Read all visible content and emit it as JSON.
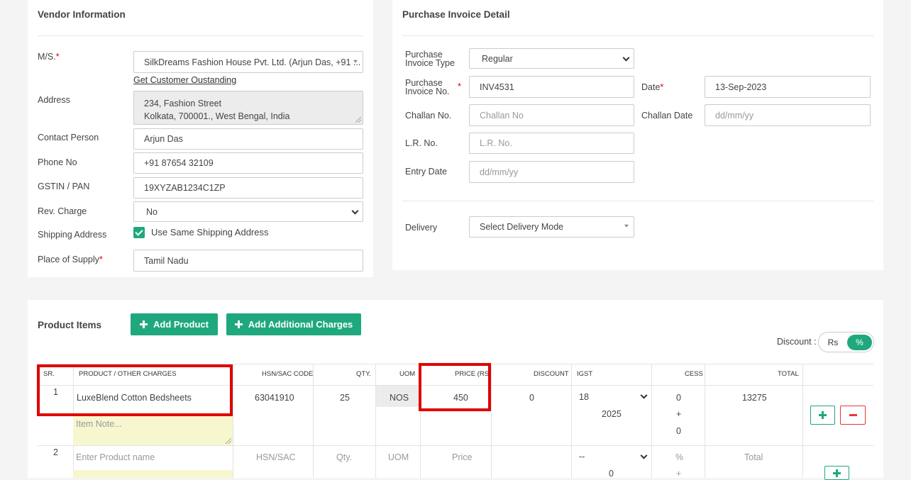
{
  "vendor": {
    "title": "Vendor Information",
    "ms_label": "M/S.",
    "required_mark": "*",
    "ms_value": "SilkDreams Fashion House Pvt. Ltd. (Arjun Das, +91 ...",
    "outstanding_link": "Get Customer Oustanding",
    "address_label": "Address",
    "address_line1": "234, Fashion Street",
    "address_line2": "Kolkata, 700001., West Bengal, India",
    "contact_label": "Contact Person",
    "contact_value": "Arjun Das",
    "phone_label": "Phone No",
    "phone_value": "+91 87654 32109",
    "gstin_label": "GSTIN / PAN",
    "gstin_value": "19XYZAB1234C1ZP",
    "rev_label": "Rev. Charge",
    "rev_value": "No",
    "shipping_label": "Shipping Address",
    "same_shipping_label": "Use Same Shipping Address",
    "same_shipping_checked": true,
    "supply_label": "Place of Supply",
    "supply_value": "Tamil Nadu"
  },
  "invoice": {
    "title": "Purchase Invoice Detail",
    "type_label_1": "Purchase",
    "type_label_2": "Invoice Type",
    "type_value": "Regular",
    "no_label_1": "Purchase",
    "no_label_2": "Invoice No.",
    "no_value": "INV4531",
    "date_label": "Date",
    "date_value": "13-Sep-2023",
    "challan_label": "Challan No.",
    "challan_placeholder": "Challan No",
    "challan_date_label": "Challan Date",
    "challan_date_placeholder": "dd/mm/yy",
    "lr_label": "L.R. No.",
    "lr_placeholder": "L.R. No.",
    "entry_label": "Entry Date",
    "entry_placeholder": "dd/mm/yy",
    "delivery_label": "Delivery",
    "delivery_value": "Select Delivery Mode"
  },
  "products": {
    "title": "Product Items",
    "add_product": "Add Product",
    "add_charges": "Add Additional Charges",
    "discount_label": "Discount :",
    "discount_rs": "Rs",
    "discount_pct": "%",
    "discount_mode": "%",
    "columns": [
      "SR.",
      "PRODUCT / OTHER CHARGES",
      "HSN/SAC CODE",
      "QTY.",
      "UOM",
      "PRICE (RS)",
      "DISCOUNT",
      "IGST",
      "CESS",
      "TOTAL"
    ],
    "row1": {
      "sr": "1",
      "product": "LuxeBlend Cotton Bedsheets",
      "note_placeholder": "Item Note...",
      "hsn": "63041910",
      "qty": "25",
      "uom": "NOS",
      "price": "450",
      "discount": "0",
      "igst_rate": "18",
      "igst_amount": "2025",
      "cess_1": "0",
      "cess_plus": "+",
      "cess_2": "0",
      "total": "13275"
    },
    "row2": {
      "sr": "2",
      "product_placeholder": "Enter Product name",
      "hsn_placeholder": "HSN/SAC",
      "qty_placeholder": "Qty.",
      "uom_placeholder": "UOM",
      "price_placeholder": "Price",
      "igst_rate": "--",
      "igst_amount": "0",
      "cess_1": "%",
      "cess_plus": "+",
      "total_placeholder": "Total"
    }
  },
  "colors": {
    "accent": "#1fa87e",
    "highlight": "#e00000",
    "remove": "#e53935"
  }
}
